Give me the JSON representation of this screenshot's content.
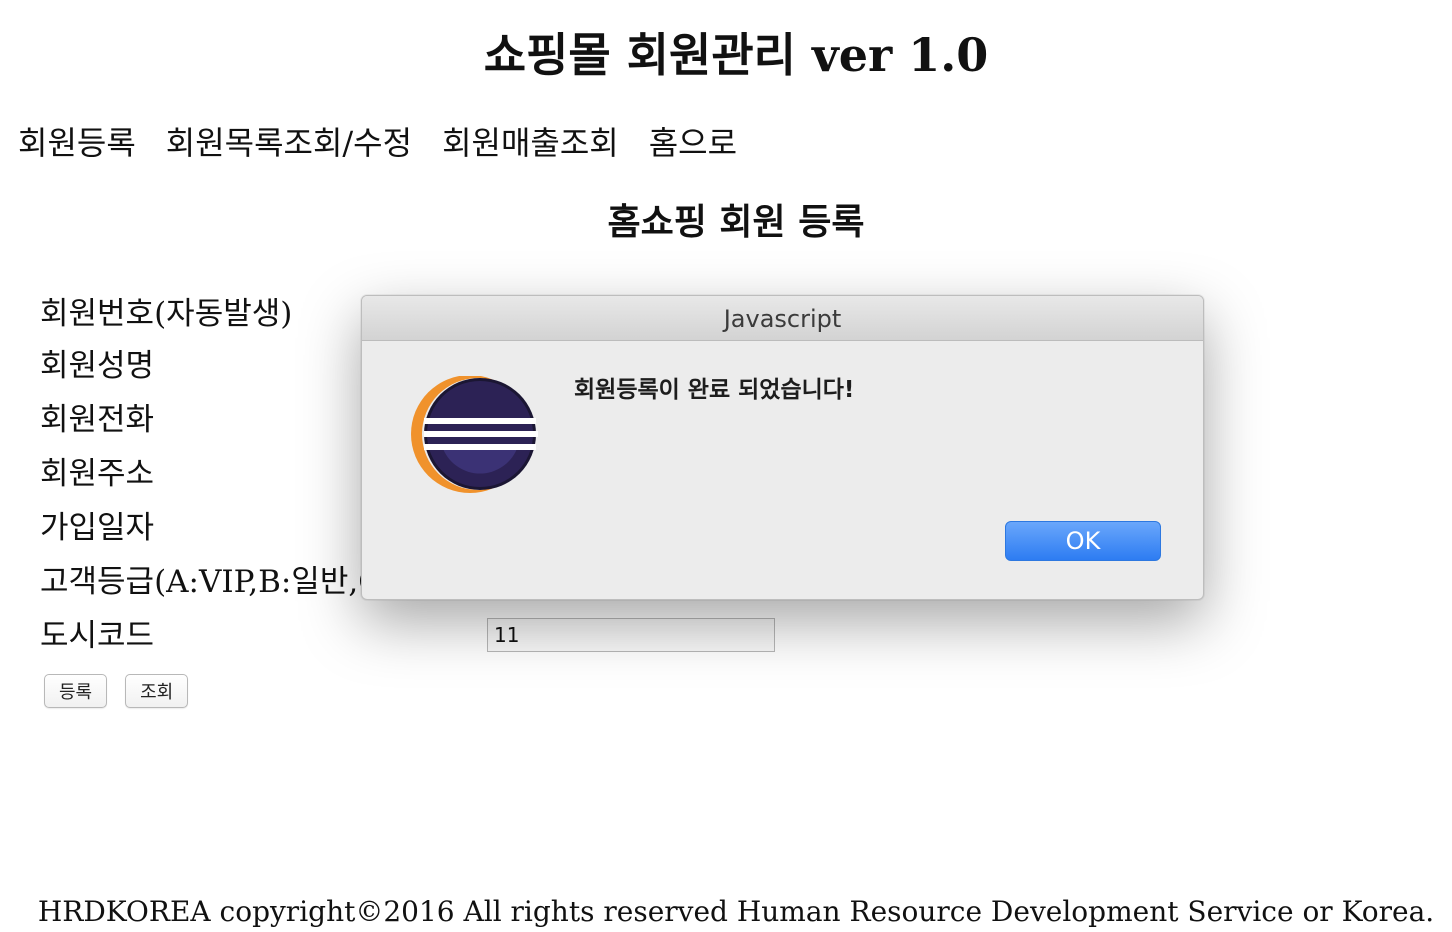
{
  "header": {
    "title": "쇼핑몰 회원관리 ver 1.0"
  },
  "nav": {
    "items": [
      {
        "label": "회원등록"
      },
      {
        "label": "회원목록조회/수정"
      },
      {
        "label": "회원매출조회"
      },
      {
        "label": "홈으로"
      }
    ]
  },
  "main": {
    "title": "홈쇼핑 회원 등록",
    "fields": [
      {
        "label": "회원번호(자동발생)",
        "value": ""
      },
      {
        "label": "회원성명",
        "value": ""
      },
      {
        "label": "회원전화",
        "value": ""
      },
      {
        "label": "회원주소",
        "value": ""
      },
      {
        "label": "가입일자",
        "value": ""
      },
      {
        "label": "고객등급(A:VIP,B:일반,C:직원)",
        "value": ""
      },
      {
        "label": "도시코드",
        "value": "11"
      }
    ],
    "buttons": {
      "register_label": "등록",
      "lookup_label": "조회"
    }
  },
  "footer": {
    "text": "HRDKOREA copyright©2016 All rights reserved Human Resource Development Service or Korea."
  },
  "dialog": {
    "title": "Javascript",
    "message": "회원등록이 완료 되었습니다!",
    "ok_label": "OK",
    "icon": "eclipse-icon",
    "accent_color": "#2d7cf2",
    "icon_colors": {
      "crescent": "#f0922c",
      "sphere": "#2c2255",
      "stripes": "#ffffff"
    }
  }
}
